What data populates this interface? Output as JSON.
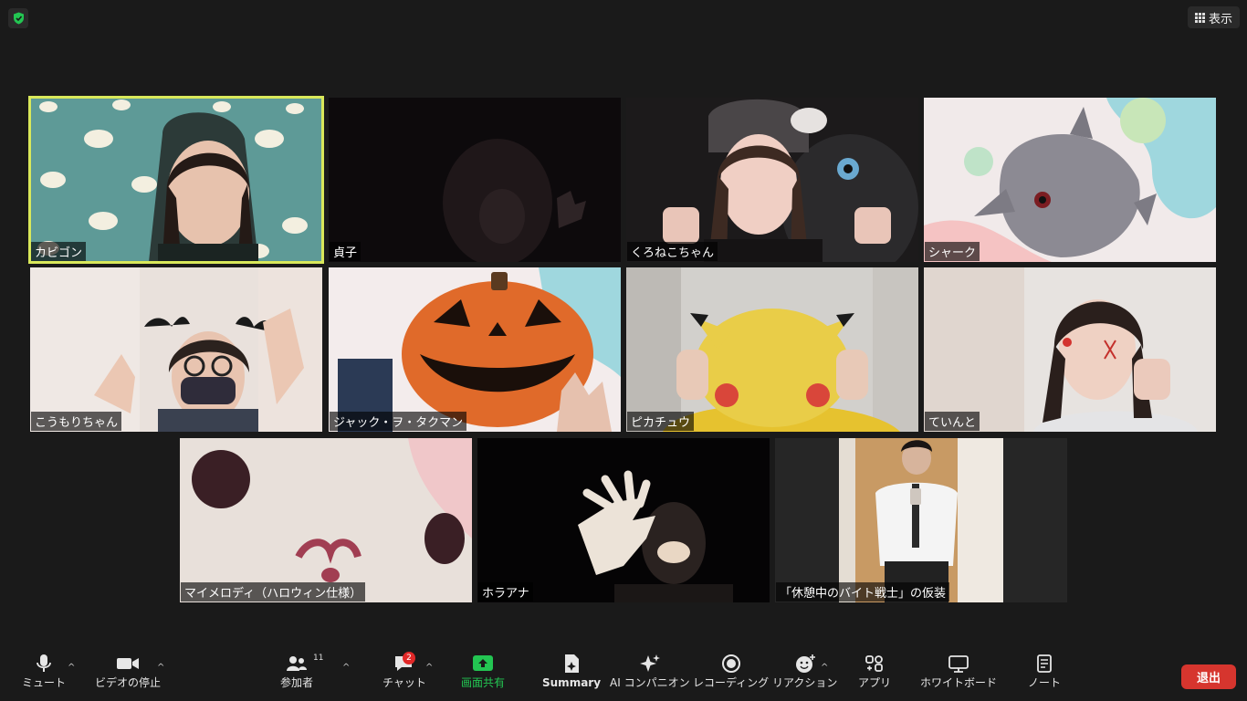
{
  "top": {
    "view_label": "表示"
  },
  "participants": [
    {
      "name": "カビゴン"
    },
    {
      "name": "貞子"
    },
    {
      "name": "くろねこちゃん"
    },
    {
      "name": "シャーク"
    },
    {
      "name": "こうもりちゃん"
    },
    {
      "name": "ジャック・ヲ・タクマン"
    },
    {
      "name": "ピカチュウ"
    },
    {
      "name": "ていんと"
    },
    {
      "name": "マイメロディ（ハロウィン仕様）"
    },
    {
      "name": "ホラアナ"
    },
    {
      "name": "「休憩中のバイト戦士」の仮装"
    }
  ],
  "toolbar": {
    "mute": "ミュート",
    "video": "ビデオの停止",
    "participants": "参加者",
    "participants_count": "11",
    "chat": "チャット",
    "chat_badge": "2",
    "share": "画面共有",
    "summary": "Summary",
    "ai": "AI コンパニオン",
    "record": "レコーディング",
    "reaction": "リアクション",
    "apps": "アプリ",
    "whiteboard": "ホワイトボード",
    "notes": "ノート",
    "leave": "退出"
  },
  "colors": {
    "active_border": "#d9e85a",
    "share_green": "#23c552",
    "leave_red": "#d6352e"
  }
}
